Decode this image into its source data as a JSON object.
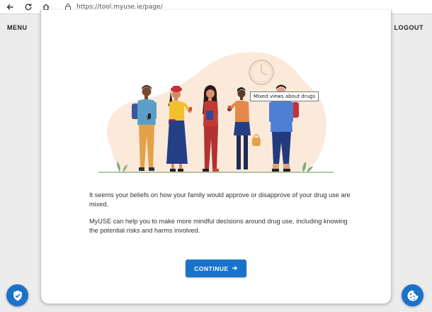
{
  "browser": {
    "url": "https://tool.myuse.ie/page/"
  },
  "nav": {
    "menu_label": "MENU",
    "logout_label": "LOGOUT"
  },
  "illustration": {
    "tooltip": "Mixed views about drugs"
  },
  "content": {
    "paragraph1": "It seems your beliefs on how your family would approve or disapprove of your drug use are mixed.",
    "paragraph2": "MyUSE can help you to make more mindful decisions around drug use, including knowing the potential risks and harms involved."
  },
  "actions": {
    "continue_label": "CONTINUE",
    "continue_arrow": "➔"
  },
  "colors": {
    "accent": "#1a73c9",
    "blob": "#fbe9da"
  },
  "icons": {
    "back": "back-arrow-icon",
    "reload": "reload-icon",
    "home": "home-icon",
    "lock": "lock-icon",
    "shield": "shield-check-icon",
    "cookie": "cookie-icon"
  }
}
